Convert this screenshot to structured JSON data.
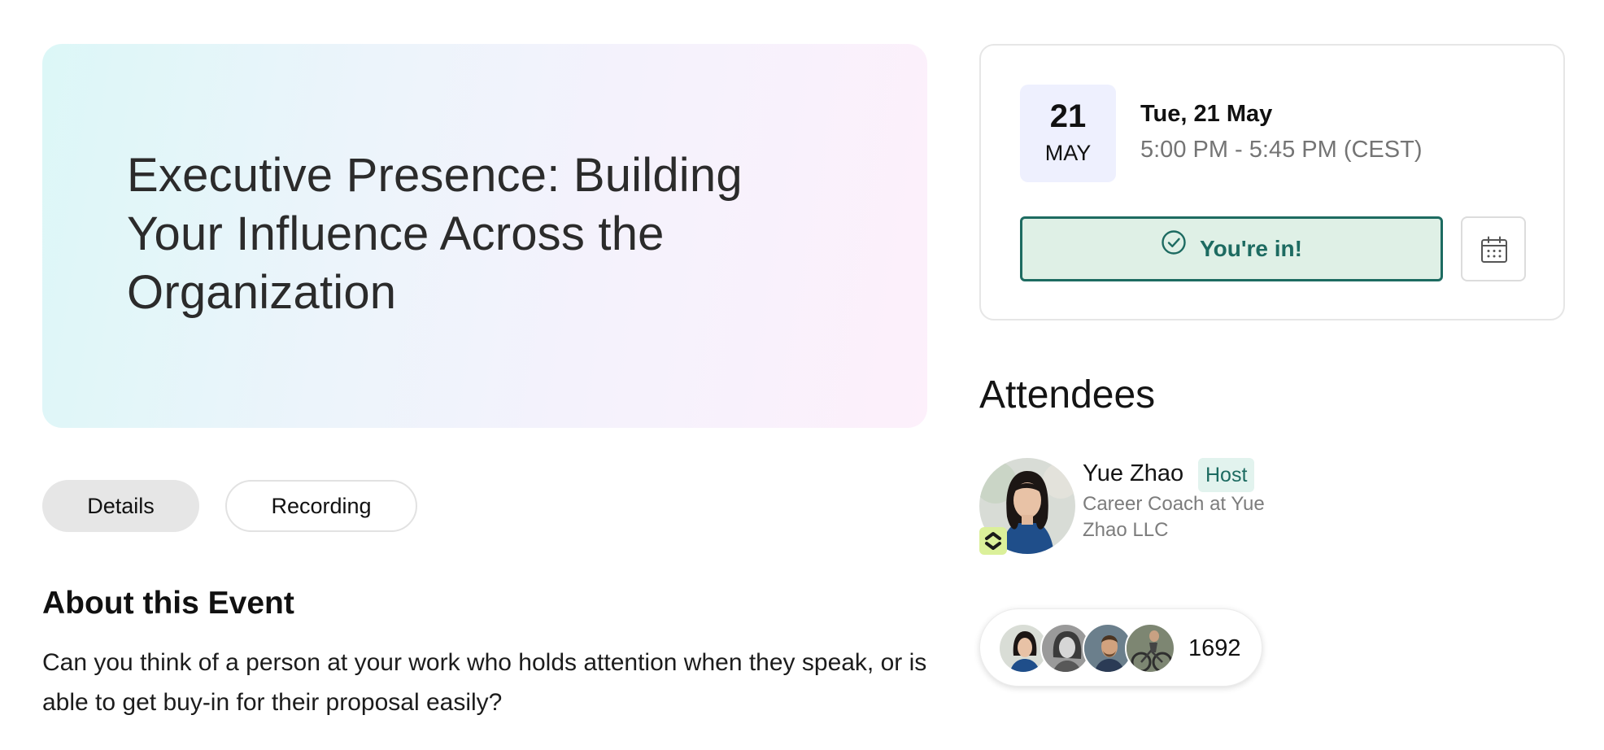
{
  "event": {
    "title": "Executive Presence: Building Your Influence Across the Organization"
  },
  "tabs": [
    {
      "label": "Details",
      "active": true
    },
    {
      "label": "Recording",
      "active": false
    }
  ],
  "about": {
    "heading": "About this Event",
    "body": "Can you think of a person at your work who holds attention when they speak, or is able to get buy-in for their proposal easily?"
  },
  "schedule": {
    "day": "21",
    "month": "MAY",
    "date_full": "Tue, 21 May",
    "time_range": "5:00 PM - 5:45 PM (CEST)",
    "rsvp_label": "You're in!",
    "rsvp_icon": "check-circle-icon",
    "calendar_icon": "calendar-icon"
  },
  "attendees": {
    "heading": "Attendees",
    "host": {
      "name": "Yue Zhao",
      "tag": "Host",
      "role": "Career Coach at Yue Zhao LLC"
    },
    "count": "1692"
  },
  "colors": {
    "accent": "#1d6b61",
    "accent_bg": "#dff0e6",
    "date_badge_bg": "#eef0fe",
    "host_badge": "#dbf09a"
  }
}
